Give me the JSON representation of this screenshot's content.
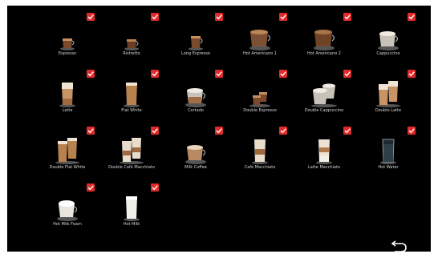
{
  "colors": {
    "background": "#000000",
    "check": "#e32a2a",
    "label": "#d6d6d6"
  },
  "drinks": [
    {
      "label": "Espresso",
      "icon": "espresso-cup-icon",
      "selected": true
    },
    {
      "label": "Ristretto",
      "icon": "ristretto-cup-icon",
      "selected": true
    },
    {
      "label": "Long Espresso",
      "icon": "long-espresso-cup-icon",
      "selected": true
    },
    {
      "label": "Hot Americano 1",
      "icon": "americano-cup-icon",
      "selected": true
    },
    {
      "label": "Hot Americano 2",
      "icon": "americano-cup-icon",
      "selected": true
    },
    {
      "label": "Cappuccino",
      "icon": "cappuccino-cup-icon",
      "selected": true
    },
    {
      "label": "Latte",
      "icon": "latte-glass-icon",
      "selected": true
    },
    {
      "label": "Flat White",
      "icon": "flat-white-glass-icon",
      "selected": true
    },
    {
      "label": "Cortado",
      "icon": "cortado-cup-icon",
      "selected": true
    },
    {
      "label": "Double Espresso",
      "icon": "double-espresso-cups-icon",
      "selected": true
    },
    {
      "label": "Double Cappuccino",
      "icon": "double-cappuccino-cups-icon",
      "selected": true
    },
    {
      "label": "Double Latte",
      "icon": "double-latte-glasses-icon",
      "selected": true
    },
    {
      "label": "Double Flat White",
      "icon": "double-flat-white-glasses-icon",
      "selected": true
    },
    {
      "label": "Double Café Macchiato",
      "icon": "double-cafe-macchiato-glasses-icon",
      "selected": true
    },
    {
      "label": "Milk Coffee",
      "icon": "milk-coffee-cup-icon",
      "selected": true
    },
    {
      "label": "Café Macchiato",
      "icon": "cafe-macchiato-glass-icon",
      "selected": true
    },
    {
      "label": "Latte Macchiato",
      "icon": "latte-macchiato-glass-icon",
      "selected": true
    },
    {
      "label": "Hot Water",
      "icon": "hot-water-glass-icon",
      "selected": true
    },
    {
      "label": "Hot Milk Foam",
      "icon": "milk-foam-cup-icon",
      "selected": true
    },
    {
      "label": "Hot Milk",
      "icon": "hot-milk-glass-icon",
      "selected": true
    }
  ],
  "back_icon": "back-arrow-icon"
}
